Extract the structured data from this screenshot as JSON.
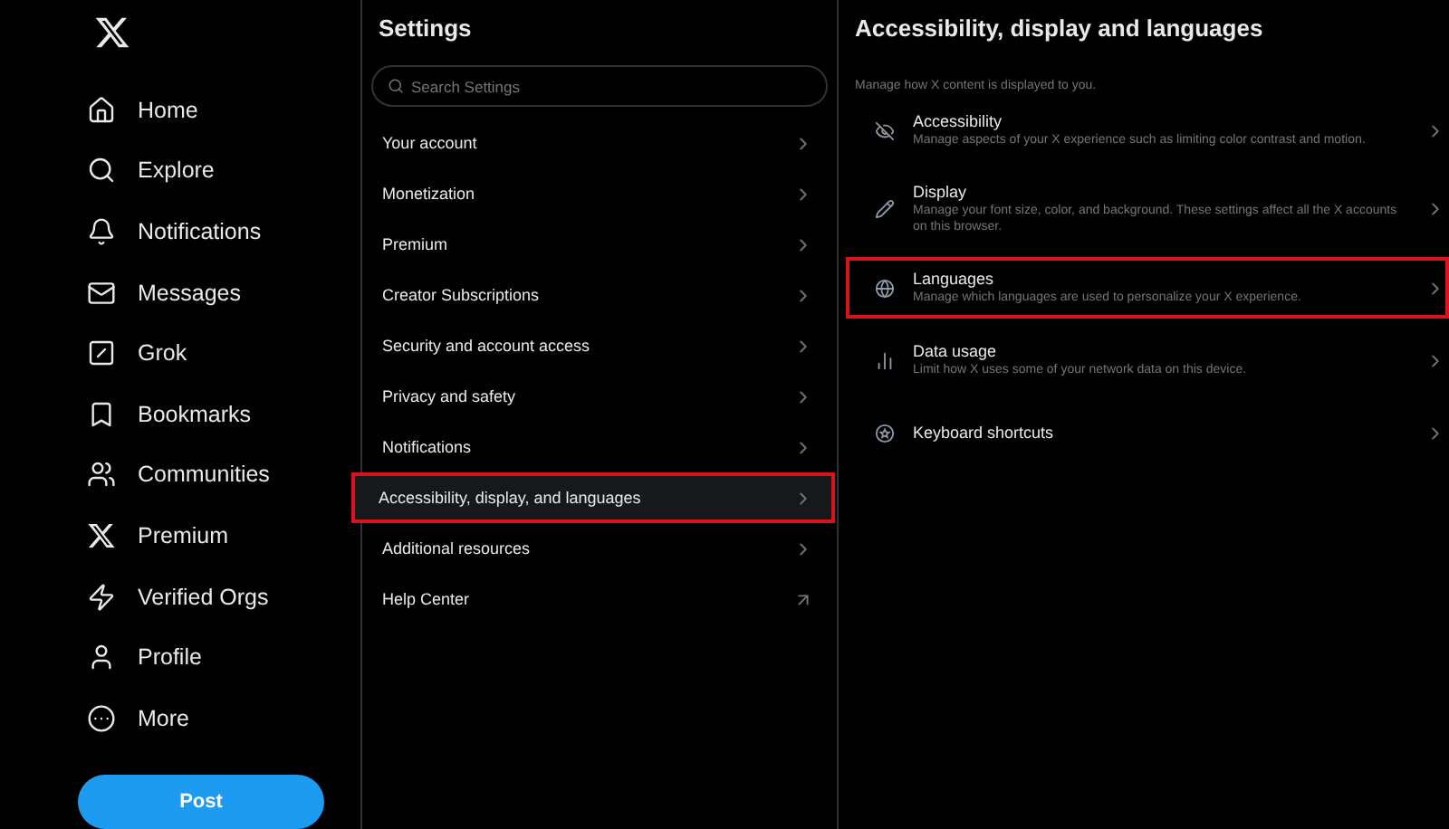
{
  "sidebar": {
    "nav": [
      {
        "kind": "home",
        "label": "Home"
      },
      {
        "kind": "explore",
        "label": "Explore"
      },
      {
        "kind": "notifications",
        "label": "Notifications"
      },
      {
        "kind": "messages",
        "label": "Messages"
      },
      {
        "kind": "grok",
        "label": "Grok"
      },
      {
        "kind": "bookmarks",
        "label": "Bookmarks"
      },
      {
        "kind": "communities",
        "label": "Communities"
      },
      {
        "kind": "premium",
        "label": "Premium"
      },
      {
        "kind": "verified",
        "label": "Verified Orgs"
      },
      {
        "kind": "profile",
        "label": "Profile"
      },
      {
        "kind": "more",
        "label": "More"
      }
    ],
    "post_button": "Post"
  },
  "settings": {
    "title": "Settings",
    "search": {
      "placeholder": "Search Settings"
    },
    "items": [
      {
        "label": "Your account",
        "kind": "page",
        "selected": false,
        "highlighted": false
      },
      {
        "label": "Monetization",
        "kind": "page",
        "selected": false,
        "highlighted": false
      },
      {
        "label": "Premium",
        "kind": "page",
        "selected": false,
        "highlighted": false
      },
      {
        "label": "Creator Subscriptions",
        "kind": "page",
        "selected": false,
        "highlighted": false
      },
      {
        "label": "Security and account access",
        "kind": "page",
        "selected": false,
        "highlighted": false
      },
      {
        "label": "Privacy and safety",
        "kind": "page",
        "selected": false,
        "highlighted": false
      },
      {
        "label": "Notifications",
        "kind": "page",
        "selected": false,
        "highlighted": false
      },
      {
        "label": "Accessibility, display, and languages",
        "kind": "page",
        "selected": true,
        "highlighted": true
      },
      {
        "label": "Additional resources",
        "kind": "page",
        "selected": false,
        "highlighted": false
      },
      {
        "label": "Help Center",
        "kind": "external",
        "selected": false,
        "highlighted": false
      }
    ]
  },
  "detail": {
    "title": "Accessibility, display and languages",
    "subtitle": "Manage how X content is displayed to you.",
    "items": [
      {
        "kind": "accessibility",
        "title": "Accessibility",
        "description": "Manage aspects of your X experience such as limiting color contrast and motion.",
        "highlighted": false
      },
      {
        "kind": "display",
        "title": "Display",
        "description": "Manage your font size, color, and background. These settings affect all the X accounts on this browser.",
        "highlighted": false
      },
      {
        "kind": "languages",
        "title": "Languages",
        "description": "Manage which languages are used to personalize your X experience.",
        "highlighted": true
      },
      {
        "kind": "data",
        "title": "Data usage",
        "description": "Limit how X uses some of your network data on this device.",
        "highlighted": false
      },
      {
        "kind": "keyboard",
        "title": "Keyboard shortcuts",
        "highlighted": false
      }
    ]
  }
}
